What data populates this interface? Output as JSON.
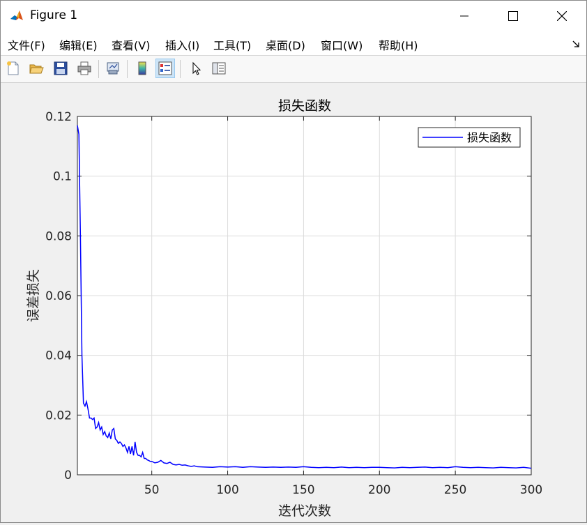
{
  "window": {
    "title": "Figure 1"
  },
  "menu": {
    "items": [
      {
        "label": "文件(F)"
      },
      {
        "label": "编辑(E)"
      },
      {
        "label": "查看(V)"
      },
      {
        "label": "插入(I)"
      },
      {
        "label": "工具(T)"
      },
      {
        "label": "桌面(D)"
      },
      {
        "label": "窗口(W)"
      },
      {
        "label": "帮助(H)"
      }
    ]
  },
  "toolbar": {
    "buttons": [
      {
        "icon": "new-figure-icon"
      },
      {
        "icon": "open-file-icon"
      },
      {
        "icon": "save-icon"
      },
      {
        "icon": "print-icon"
      },
      {
        "icon": "link-plot-icon"
      },
      {
        "icon": "insert-colorbar-icon"
      },
      {
        "icon": "insert-legend-icon"
      },
      {
        "icon": "edit-plot-icon"
      },
      {
        "icon": "property-inspector-icon"
      }
    ]
  },
  "chart_data": {
    "type": "line",
    "title": "损失函数",
    "xlabel": "迭代次数",
    "ylabel": "误差损失",
    "xlim": [
      1,
      300
    ],
    "ylim": [
      0,
      0.12
    ],
    "x_ticks": [
      50,
      100,
      150,
      200,
      250,
      300
    ],
    "x_tick_labels": [
      "50",
      "100",
      "150",
      "200",
      "250",
      "300"
    ],
    "y_ticks": [
      0,
      0.02,
      0.04,
      0.06,
      0.08,
      0.1,
      0.12
    ],
    "y_tick_labels": [
      "0",
      "0.02",
      "0.04",
      "0.06",
      "0.08",
      "0.1",
      "0.12"
    ],
    "grid": true,
    "legend_position": "top-right",
    "series": [
      {
        "name": "损失函数",
        "color": "#0000ff",
        "x": [
          1,
          2,
          3,
          4,
          5,
          6,
          7,
          8,
          9,
          10,
          11,
          12,
          13,
          14,
          15,
          16,
          17,
          18,
          19,
          20,
          21,
          22,
          23,
          24,
          25,
          26,
          27,
          28,
          29,
          30,
          31,
          32,
          33,
          34,
          35,
          36,
          37,
          38,
          39,
          40,
          41,
          42,
          43,
          44,
          45,
          46,
          47,
          48,
          49,
          50,
          52,
          54,
          56,
          58,
          60,
          62,
          64,
          66,
          68,
          70,
          72,
          74,
          76,
          78,
          80,
          85,
          90,
          95,
          100,
          105,
          110,
          115,
          120,
          125,
          130,
          135,
          140,
          145,
          150,
          155,
          160,
          165,
          170,
          175,
          180,
          185,
          190,
          195,
          200,
          205,
          210,
          215,
          220,
          225,
          230,
          235,
          240,
          245,
          250,
          255,
          260,
          265,
          270,
          275,
          280,
          285,
          290,
          295,
          300
        ],
        "y": [
          0.117,
          0.114,
          0.08,
          0.04,
          0.024,
          0.023,
          0.0245,
          0.022,
          0.019,
          0.019,
          0.0185,
          0.019,
          0.0155,
          0.016,
          0.0175,
          0.015,
          0.016,
          0.0135,
          0.0145,
          0.013,
          0.0125,
          0.014,
          0.012,
          0.015,
          0.0155,
          0.012,
          0.0115,
          0.0105,
          0.011,
          0.0105,
          0.0095,
          0.01,
          0.009,
          0.0075,
          0.0095,
          0.007,
          0.0095,
          0.0065,
          0.011,
          0.0075,
          0.0065,
          0.0065,
          0.006,
          0.0075,
          0.0055,
          0.0055,
          0.005,
          0.0048,
          0.0045,
          0.0045,
          0.004,
          0.0042,
          0.0048,
          0.004,
          0.0038,
          0.0042,
          0.0035,
          0.0033,
          0.0035,
          0.0032,
          0.0033,
          0.003,
          0.0028,
          0.003,
          0.0027,
          0.0026,
          0.0025,
          0.0027,
          0.0026,
          0.0027,
          0.0025,
          0.0027,
          0.0026,
          0.0025,
          0.0026,
          0.0025,
          0.0026,
          0.0025,
          0.0027,
          0.0025,
          0.0024,
          0.0025,
          0.0024,
          0.0026,
          0.0024,
          0.0025,
          0.0024,
          0.0025,
          0.0025,
          0.0024,
          0.0023,
          0.0025,
          0.0024,
          0.0025,
          0.0026,
          0.0024,
          0.0025,
          0.0024,
          0.0027,
          0.0025,
          0.0024,
          0.0025,
          0.0024,
          0.0023,
          0.0025,
          0.0024,
          0.0023,
          0.0025,
          0.0022
        ]
      }
    ]
  }
}
